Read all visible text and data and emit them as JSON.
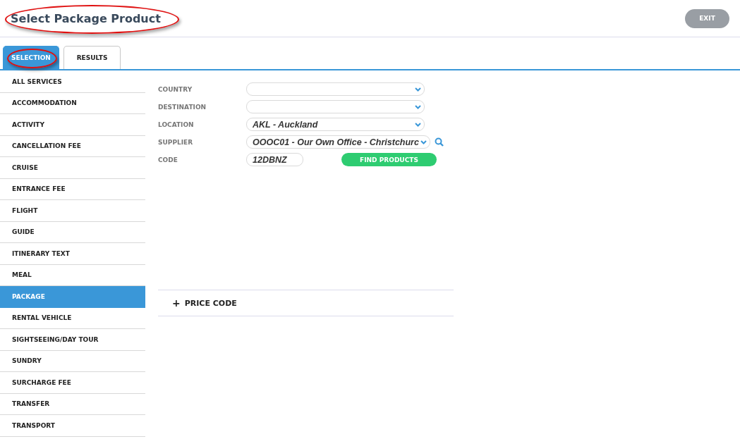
{
  "header": {
    "title": "Select Package Product",
    "title_highlighted": true,
    "exit_button": "EXIT"
  },
  "tabs": [
    {
      "label": "SELECTION",
      "selected": true,
      "highlighted": true
    },
    {
      "label": "RESULTS",
      "selected": false,
      "highlighted": false
    }
  ],
  "sidebar": {
    "items": [
      {
        "label": "ALL SERVICES",
        "selected": false
      },
      {
        "label": "ACCOMMODATION",
        "selected": false
      },
      {
        "label": "ACTIVITY",
        "selected": false
      },
      {
        "label": "CANCELLATION FEE",
        "selected": false
      },
      {
        "label": "CRUISE",
        "selected": false
      },
      {
        "label": "ENTRANCE FEE",
        "selected": false
      },
      {
        "label": "FLIGHT",
        "selected": false
      },
      {
        "label": "GUIDE",
        "selected": false
      },
      {
        "label": "ITINERARY TEXT",
        "selected": false
      },
      {
        "label": "MEAL",
        "selected": false
      },
      {
        "label": "PACKAGE",
        "selected": true
      },
      {
        "label": "RENTAL VEHICLE",
        "selected": false
      },
      {
        "label": "SIGHTSEEING/DAY TOUR",
        "selected": false
      },
      {
        "label": "SUNDRY",
        "selected": false
      },
      {
        "label": "SURCHARGE FEE",
        "selected": false
      },
      {
        "label": "TRANSFER",
        "selected": false
      },
      {
        "label": "TRANSPORT",
        "selected": false
      }
    ]
  },
  "form": {
    "fields": [
      {
        "kind": "select",
        "label": "COUNTRY"
      },
      {
        "kind": "select",
        "label": "DESTINATION"
      },
      {
        "kind": "select",
        "label": "LOCATION",
        "value": "AKL - Auckland"
      },
      {
        "kind": "select",
        "label": "SUPPLIER",
        "value": "OOOC01 - Our Own Office - Christchurc",
        "search": true
      },
      {
        "kind": "text",
        "label": "CODE",
        "value": "12DBNZ"
      }
    ],
    "find_button": "FIND PRODUCTS"
  },
  "price_code": {
    "toggle": "+",
    "label": "PRICE CODE"
  }
}
